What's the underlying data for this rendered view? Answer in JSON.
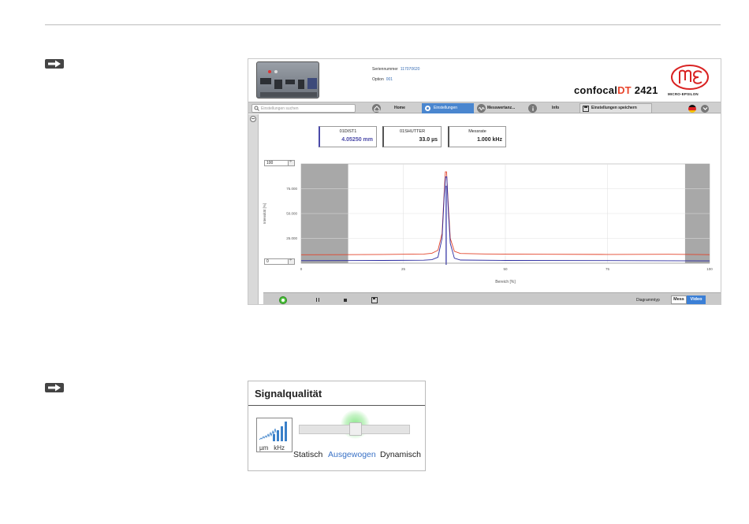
{
  "app": {
    "serial_label": "Seriennummer",
    "serial_value": "117070620",
    "option_label": "Option",
    "option_value": "001",
    "brand_prefix": "confocal",
    "brand_dt": "DT",
    "brand_model": "2421",
    "logo_text": "MICRO-EPSILON"
  },
  "nav": {
    "search_placeholder": "Einstellungen suchen",
    "home": "Home",
    "settings": "Einstellungen",
    "measure": "Messwertanz...",
    "info": "Info",
    "save": "Einstellungen speichern"
  },
  "values": [
    {
      "label": "01DIST1",
      "value": "4.05250 mm"
    },
    {
      "label": "01SHUTTER",
      "value": "33.0 µs"
    },
    {
      "label": "Messrate",
      "value": "1.000 kHz"
    }
  ],
  "spin": {
    "top": "100",
    "bottom": "0"
  },
  "bottom_bar": {
    "diagram_type_label": "Diagrammtyp",
    "mess": "Mess",
    "video": "Video"
  },
  "colors": {
    "accent": "#4a86cf",
    "red_line": "#e2432a",
    "blue_line": "#2a2aa0",
    "mask": "#a8a8a8"
  },
  "chart_data": {
    "type": "line",
    "xlabel": "Bereich [%]",
    "ylabel": "Intensität [%]",
    "xlim": [
      0,
      100
    ],
    "ylim": [
      0,
      100
    ],
    "x_ticks": [
      "0",
      "25",
      "50",
      "75",
      "100"
    ],
    "y_ticks": [
      "25.000",
      "50.000",
      "75.000"
    ],
    "masked_ranges": [
      [
        0,
        11.5
      ],
      [
        94,
        100
      ]
    ],
    "peak_marker_x": 35.5,
    "series": [
      {
        "color": "#e2432a",
        "points": [
          [
            0,
            8.5
          ],
          [
            10,
            8.6
          ],
          [
            20,
            8.8
          ],
          [
            30,
            9.2
          ],
          [
            32,
            10
          ],
          [
            33.5,
            13
          ],
          [
            34.5,
            30
          ],
          [
            35,
            70
          ],
          [
            35.3,
            92
          ],
          [
            35.6,
            92
          ],
          [
            36,
            60
          ],
          [
            36.5,
            25
          ],
          [
            37.5,
            12
          ],
          [
            39,
            9.8
          ],
          [
            45,
            9.3
          ],
          [
            60,
            9.0
          ],
          [
            75,
            8.8
          ],
          [
            90,
            9.0
          ],
          [
            100,
            8.6
          ]
        ]
      },
      {
        "color": "#2a2aa0",
        "points": [
          [
            0,
            2.5
          ],
          [
            10,
            2.6
          ],
          [
            20,
            2.8
          ],
          [
            30,
            3.0
          ],
          [
            32,
            3.5
          ],
          [
            33.5,
            6
          ],
          [
            34.5,
            25
          ],
          [
            35,
            66
          ],
          [
            35.35,
            87
          ],
          [
            35.65,
            87
          ],
          [
            36,
            55
          ],
          [
            36.5,
            20
          ],
          [
            37.5,
            5
          ],
          [
            39,
            3.2
          ],
          [
            50,
            2.8
          ],
          [
            75,
            2.6
          ],
          [
            100,
            2.3
          ]
        ]
      }
    ]
  },
  "signal_quality": {
    "title": "Signalqualität",
    "unit_left": "µm",
    "unit_right": "kHz",
    "options": [
      "Statisch",
      "Ausgewogen",
      "Dynamisch"
    ],
    "selected": "Ausgewogen",
    "slider_level": 0.5
  }
}
